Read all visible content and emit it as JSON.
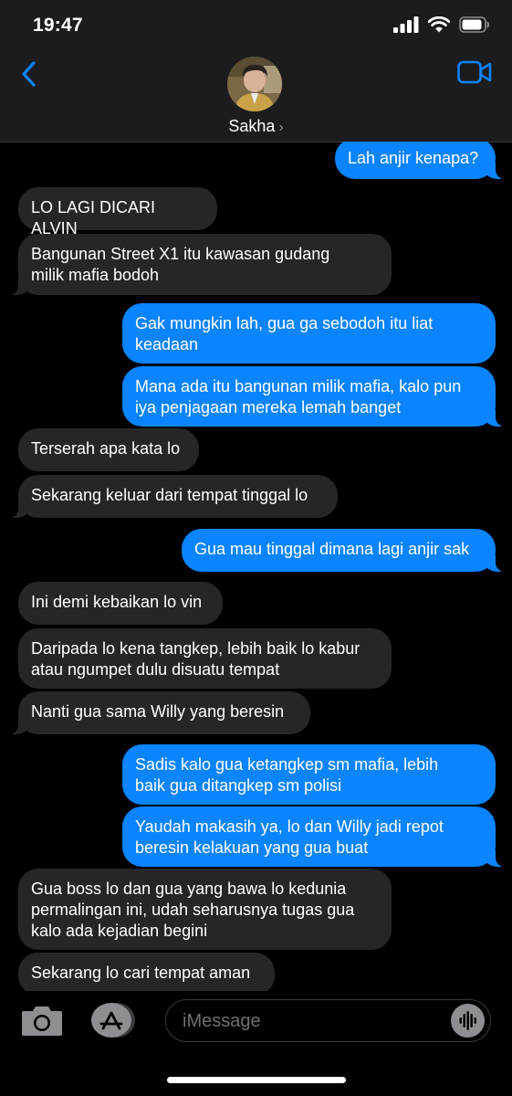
{
  "status_bar": {
    "time": "19:47"
  },
  "header": {
    "contact_name": "Sakha",
    "chevron": "›"
  },
  "icons": {
    "back": "chevron-left-icon",
    "video": "video-camera-icon",
    "camera": "camera-icon",
    "app_store": "app-store-icon",
    "audio": "audio-waveform-icon"
  },
  "colors": {
    "outgoing": "#0a84ff",
    "incoming": "#262628",
    "accent": "#0a84ff"
  },
  "messages": [
    {
      "dir": "out",
      "text": "Lah anjir kenapa?"
    },
    {
      "dir": "in",
      "text": "LO LAGI DICARI ALVIN"
    },
    {
      "dir": "in",
      "text": "Bangunan Street X1 itu kawasan gudang\nmilik mafia bodoh"
    },
    {
      "dir": "out",
      "text": "Gak mungkin lah, gua ga sebodoh itu liat\nkeadaan"
    },
    {
      "dir": "out",
      "text": "Mana ada itu bangunan milik mafia, kalo pun\niya penjagaan mereka lemah banget"
    },
    {
      "dir": "in",
      "text": "Terserah apa kata lo"
    },
    {
      "dir": "in",
      "text": "Sekarang keluar dari tempat tinggal lo"
    },
    {
      "dir": "out",
      "text": "Gua mau tinggal dimana lagi anjir sak"
    },
    {
      "dir": "in",
      "text": "Ini demi kebaikan lo vin"
    },
    {
      "dir": "in",
      "text": "Daripada lo kena tangkep, lebih baik lo kabur\natau ngumpet dulu disuatu tempat"
    },
    {
      "dir": "in",
      "text": "Nanti gua sama Willy yang beresin"
    },
    {
      "dir": "out",
      "text": "Sadis kalo gua ketangkep sm mafia, lebih\nbaik gua ditangkep sm polisi"
    },
    {
      "dir": "out",
      "text": "Yaudah makasih ya, lo dan Willy jadi repot\nberesin kelakuan yang gua buat"
    },
    {
      "dir": "in",
      "text": "Gua boss lo dan gua yang bawa lo kedunia\npermalingan ini, udah seharusnya tugas gua\nkalo ada kejadian begini"
    },
    {
      "dir": "in",
      "text": "Sekarang lo cari tempat aman"
    }
  ],
  "composer": {
    "placeholder": "iMessage"
  }
}
